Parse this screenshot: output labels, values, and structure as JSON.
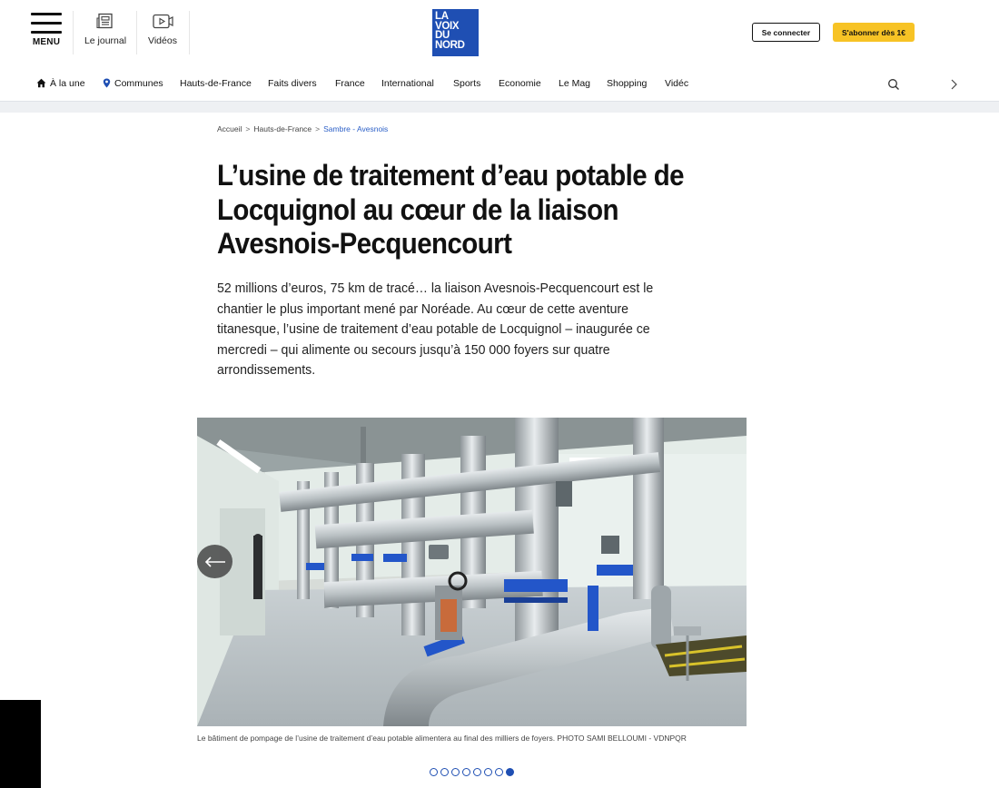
{
  "header": {
    "menu_label": "MENU",
    "journal_label": "Le journal",
    "videos_label": "Vidéos",
    "logo_lines": [
      "LA",
      "VOIX",
      "DU",
      "NORD"
    ],
    "login_label": "Se connecter",
    "subscribe_label": "S'abonner dès 1€"
  },
  "nav": {
    "items": [
      "À la une",
      "Communes",
      "Hauts-de-France",
      "Faits divers",
      "France",
      "International",
      "Sports",
      "Economie",
      "Le Mag",
      "Shopping",
      "Vidéc"
    ]
  },
  "breadcrumb": {
    "items": [
      "Accueil",
      "Hauts-de-France",
      "Sambre - Avesnois"
    ],
    "separator": ">"
  },
  "article": {
    "title": "L’usine de traitement d’eau potable de Locquignol au cœur de la liaison Avesnois-Pecquencourt",
    "lead": "52 millions d’euros, 75 km de tracé… la liaison Avesnois-Pecquencourt est le chantier le plus important mené par Noréade. Au cœur de cette aventure titanesque, l’usine de traitement d’eau potable de Locquignol – inaugurée ce mercredi – qui alimente ou secours jusqu’à 150 000 foyers sur quatre arrondissements.",
    "caption": "Le bâtiment de pompage de l’usine de traitement d’eau potable alimentera au final des milliers de foyers. PHOTO SAMI BELLOUMI - VDNPQR"
  },
  "carousel": {
    "total": 8,
    "active_index": 7
  },
  "colors": {
    "brand_blue": "#1f4fb3",
    "subscribe_yellow": "#f7c325",
    "breadcrumb_link": "#2b5fc7"
  }
}
